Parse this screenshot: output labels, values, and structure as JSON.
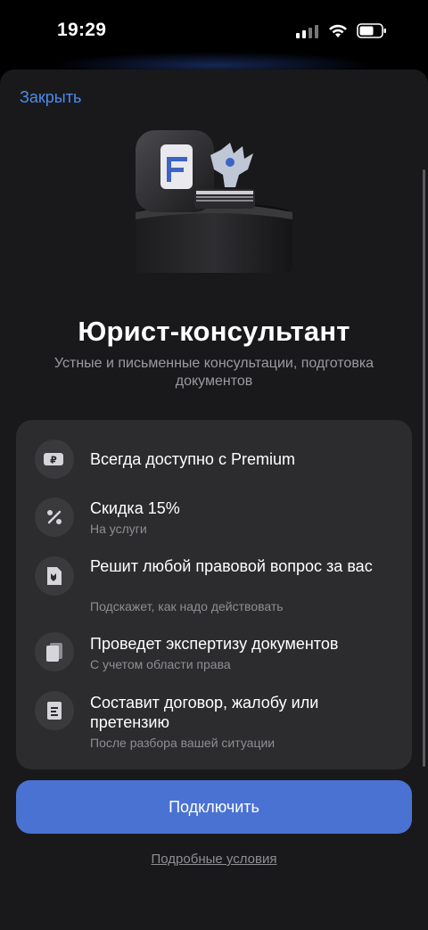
{
  "status_bar": {
    "time": "19:29"
  },
  "header": {
    "close_label": "Закрыть"
  },
  "hero": {
    "title": "Юрист-консультант",
    "subtitle": "Устные и письменные консультации, подготовка документов"
  },
  "features": [
    {
      "icon": "ruble-card-icon",
      "title": "Всегда доступно с Premium",
      "subtitle": ""
    },
    {
      "icon": "percent-icon",
      "title": "Скидка 15%",
      "subtitle": "На услуги"
    },
    {
      "icon": "legal-document-icon",
      "title": "Решит любой правовой вопрос за вас",
      "subtitle": "Подскажет, как надо действовать"
    },
    {
      "icon": "documents-stack-icon",
      "title": "Проведет экспертизу документов",
      "subtitle": "С учетом области права"
    },
    {
      "icon": "contract-icon",
      "title": "Составит договор, жалобу или претензию",
      "subtitle": "После разбора вашей ситуации"
    }
  ],
  "cta": {
    "label": "Подключить"
  },
  "footer": {
    "terms_link": "Подробные условия"
  },
  "colors": {
    "accent": "#4a72d2",
    "link": "#4a8cf0",
    "card": "#2c2c2e",
    "sheet": "#19191b"
  }
}
